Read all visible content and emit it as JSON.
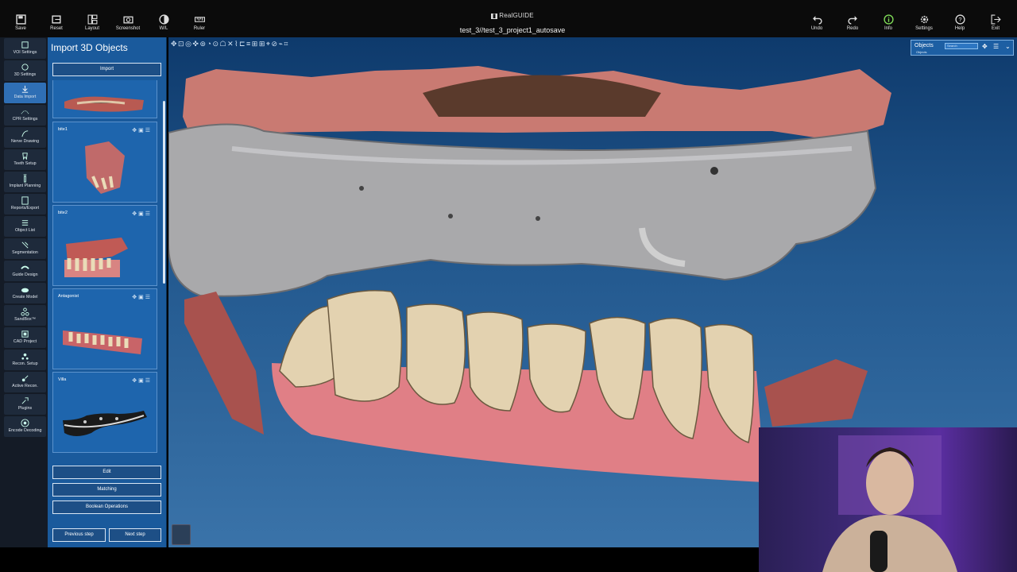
{
  "toolbar": {
    "left": [
      {
        "label": "Save",
        "icon": "save-icon"
      },
      {
        "label": "Reset",
        "icon": "reset-icon"
      },
      {
        "label": "Layout",
        "icon": "layout-icon"
      },
      {
        "label": "Screenshot",
        "icon": "camera-icon"
      },
      {
        "label": "W/L",
        "icon": "contrast-icon"
      },
      {
        "label": "Ruler",
        "icon": "ruler-icon"
      }
    ],
    "right": [
      {
        "label": "Undo",
        "icon": "undo-icon"
      },
      {
        "label": "Redo",
        "icon": "redo-icon"
      },
      {
        "label": "Info",
        "icon": "info-icon"
      },
      {
        "label": "Settings",
        "icon": "gear-icon"
      },
      {
        "label": "Help",
        "icon": "help-icon"
      },
      {
        "label": "Exit",
        "icon": "exit-icon"
      }
    ]
  },
  "app": {
    "brand": "RealGUIDE",
    "document_title": "test_3//test_3_project1_autosave"
  },
  "sidebar": {
    "items": [
      {
        "label": "VOI Settings"
      },
      {
        "label": "3D Settings"
      },
      {
        "label": "Data Import",
        "active": true
      },
      {
        "label": "CPR Settings"
      },
      {
        "label": "Nerve Drawing"
      },
      {
        "label": "Teeth Setup"
      },
      {
        "label": "Implant Planning"
      },
      {
        "label": "Reports/Export"
      },
      {
        "label": "Object List"
      },
      {
        "label": "Segmentation"
      },
      {
        "label": "Guide Design"
      },
      {
        "label": "Create Model"
      },
      {
        "label": "SandBox™"
      },
      {
        "label": "CAD Project"
      },
      {
        "label": "Recon. Setup"
      },
      {
        "label": "Active Recon."
      },
      {
        "label": "Plugins"
      },
      {
        "label": "Encode Decoding"
      }
    ]
  },
  "import_panel": {
    "title": "Import 3D Objects",
    "import_label": "Import",
    "objects": [
      {
        "name": ""
      },
      {
        "name": "bite1"
      },
      {
        "name": "bite2"
      },
      {
        "name": "Antagonist"
      },
      {
        "name": "Villa"
      }
    ],
    "edit_label": "Edit",
    "matching_label": "Matching",
    "boolean_label": "Boolean Operations",
    "prev_label": "Previous step",
    "next_label": "Next step"
  },
  "objects_panel": {
    "title": "Objects",
    "subtitle": "Objects",
    "search_placeholder": "Search"
  },
  "colors": {
    "accent": "#2f6fb5",
    "panel": "#1a5a9c",
    "viewport_top": "#0e3a6c",
    "viewport_bottom": "#3a73a9",
    "gum": "#e07a80",
    "tooth": "#e3d5b8",
    "guide": "#b9b9b9"
  }
}
